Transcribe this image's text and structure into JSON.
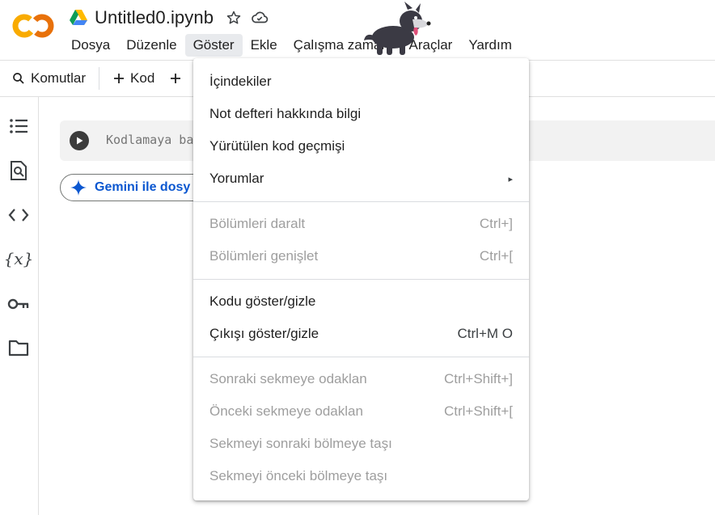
{
  "app": {
    "logo_text": "CO",
    "doc_title": "Untitled0.ipynb",
    "colors": {
      "logo_orange": "#F9AB00",
      "logo_dark": "#E8710A",
      "link_blue": "#0b57d0"
    }
  },
  "menubar": {
    "items": [
      {
        "label": "Dosya"
      },
      {
        "label": "Düzenle"
      },
      {
        "label": "Göster",
        "active": true
      },
      {
        "label": "Ekle"
      },
      {
        "label": "Çalışma zamanı"
      },
      {
        "label": "Araçlar"
      },
      {
        "label": "Yardım"
      }
    ]
  },
  "toolbar": {
    "commands_label": "Komutlar",
    "add_code_label": "Kod",
    "add_text_label": "+"
  },
  "sidebar": {
    "icons": [
      "table-of-contents-icon",
      "find-replace-icon",
      "code-snippets-icon",
      "variables-icon",
      "secrets-key-icon",
      "files-folder-icon"
    ]
  },
  "cell": {
    "placeholder": "Kodlamaya ba"
  },
  "gemini": {
    "label": "Gemini ile dosy"
  },
  "view_menu": {
    "items": [
      {
        "label": "İçindekiler",
        "shortcut": "",
        "enabled": true
      },
      {
        "label": "Not defteri hakkında bilgi",
        "shortcut": "",
        "enabled": true
      },
      {
        "label": "Yürütülen kod geçmişi",
        "shortcut": "",
        "enabled": true
      },
      {
        "label": "Yorumlar",
        "shortcut": "▸",
        "enabled": true
      },
      {
        "label": "Bölümleri daralt",
        "shortcut": "Ctrl+]",
        "enabled": false
      },
      {
        "label": "Bölümleri genişlet",
        "shortcut": "Ctrl+[",
        "enabled": false
      },
      {
        "label": "Kodu göster/gizle",
        "shortcut": "",
        "enabled": true
      },
      {
        "label": "Çıkışı göster/gizle",
        "shortcut": "Ctrl+M O",
        "enabled": true
      },
      {
        "label": "Sonraki sekmeye odaklan",
        "shortcut": "Ctrl+Shift+]",
        "enabled": false
      },
      {
        "label": "Önceki sekmeye odaklan",
        "shortcut": "Ctrl+Shift+[",
        "enabled": false
      },
      {
        "label": "Sekmeyi sonraki bölmeye taşı",
        "shortcut": "",
        "enabled": false
      },
      {
        "label": "Sekmeyi önceki bölmeye taşı",
        "shortcut": "",
        "enabled": false
      }
    ]
  }
}
